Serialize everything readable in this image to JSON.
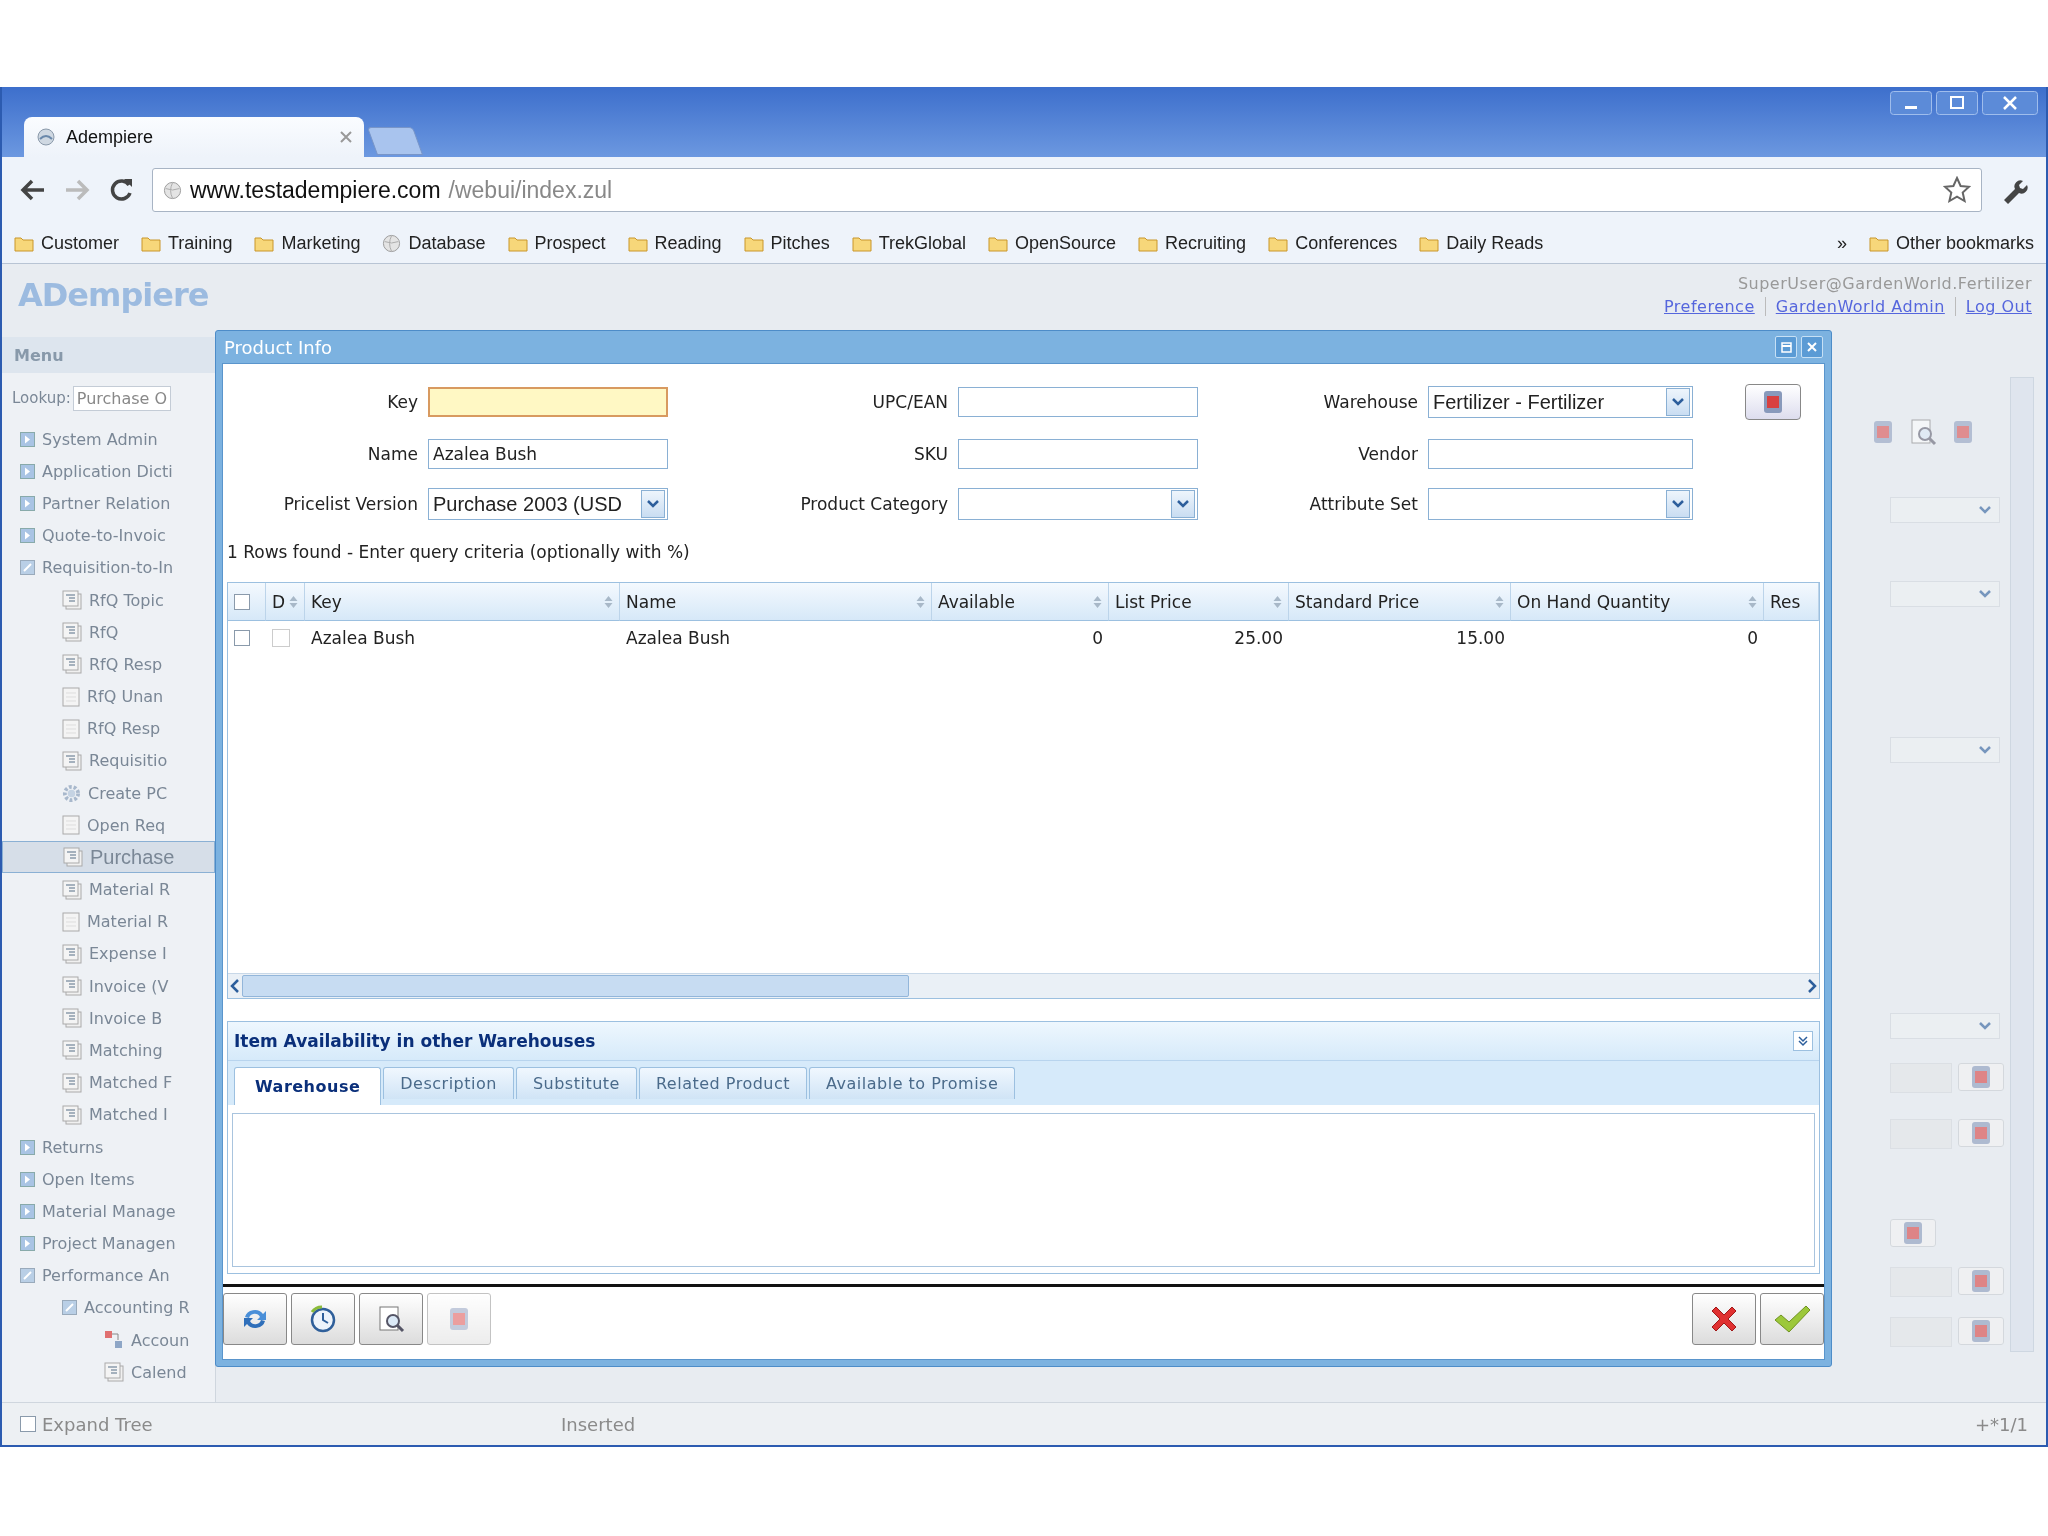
{
  "browser": {
    "tab_title": "Adempiere",
    "url_host": "www.testadempiere.com",
    "url_path": "/webui/index.zul",
    "bookmarks": [
      {
        "label": "Customer",
        "kind": "folder"
      },
      {
        "label": "Training",
        "kind": "folder"
      },
      {
        "label": "Marketing",
        "kind": "folder"
      },
      {
        "label": "Database",
        "kind": "page"
      },
      {
        "label": "Prospect",
        "kind": "folder"
      },
      {
        "label": "Reading",
        "kind": "folder"
      },
      {
        "label": "Pitches",
        "kind": "folder"
      },
      {
        "label": "TrekGlobal",
        "kind": "folder"
      },
      {
        "label": "OpenSource",
        "kind": "folder"
      },
      {
        "label": "Recruiting",
        "kind": "folder"
      },
      {
        "label": "Conferences",
        "kind": "folder"
      },
      {
        "label": "Daily Reads",
        "kind": "folder"
      }
    ],
    "overflow": "»",
    "other_bookmarks": "Other bookmarks"
  },
  "app": {
    "logo": "ADempiere",
    "user": "SuperUser@GardenWorld.Fertilizer",
    "links": [
      "Preference",
      "GardenWorld Admin",
      "Log Out"
    ],
    "menu_title": "Menu",
    "lookup_label": "Lookup:",
    "lookup_value": "Purchase O",
    "tree": [
      {
        "label": "System Admin",
        "kind": "folder",
        "expanded": false,
        "selected": false
      },
      {
        "label": "Application Dicti",
        "kind": "folder",
        "expanded": false,
        "selected": false
      },
      {
        "label": "Partner Relation",
        "kind": "folder",
        "expanded": false,
        "selected": false
      },
      {
        "label": "Quote-to-Invoic",
        "kind": "folder",
        "expanded": false,
        "selected": false
      },
      {
        "label": "Requisition-to-In",
        "kind": "folder",
        "expanded": true,
        "selected": false,
        "children": [
          {
            "label": "RfQ Topic",
            "kind": "window",
            "selected": false
          },
          {
            "label": "RfQ",
            "kind": "window",
            "selected": false
          },
          {
            "label": "RfQ Resp",
            "kind": "window",
            "selected": false
          },
          {
            "label": "RfQ Unan",
            "kind": "report",
            "selected": false
          },
          {
            "label": "RfQ Resp",
            "kind": "report",
            "selected": false
          },
          {
            "label": "Requisitio",
            "kind": "window",
            "selected": false
          },
          {
            "label": "Create PC",
            "kind": "process",
            "selected": false
          },
          {
            "label": "Open Req",
            "kind": "report",
            "selected": false
          },
          {
            "label": "Purchase",
            "kind": "window",
            "selected": true
          },
          {
            "label": "Material R",
            "kind": "window",
            "selected": false
          },
          {
            "label": "Material R",
            "kind": "report",
            "selected": false
          },
          {
            "label": "Expense I",
            "kind": "window",
            "selected": false
          },
          {
            "label": "Invoice (V",
            "kind": "window",
            "selected": false
          },
          {
            "label": "Invoice B",
            "kind": "window",
            "selected": false
          },
          {
            "label": "Matching",
            "kind": "window",
            "selected": false
          },
          {
            "label": "Matched F",
            "kind": "window",
            "selected": false
          },
          {
            "label": "Matched I",
            "kind": "window",
            "selected": false
          }
        ]
      },
      {
        "label": "Returns",
        "kind": "folder",
        "expanded": false,
        "selected": false
      },
      {
        "label": "Open Items",
        "kind": "folder",
        "expanded": false,
        "selected": false
      },
      {
        "label": "Material Manage",
        "kind": "folder",
        "expanded": false,
        "selected": false
      },
      {
        "label": "Project Managen",
        "kind": "folder",
        "expanded": false,
        "selected": false
      },
      {
        "label": "Performance An",
        "kind": "folder",
        "expanded": true,
        "selected": false,
        "children": [
          {
            "label": "Accounting R",
            "kind": "folder",
            "expanded": true,
            "selected": false,
            "children": [
              {
                "label": "Accoun",
                "kind": "workflow",
                "selected": false
              },
              {
                "label": "Calend",
                "kind": "window",
                "selected": false
              }
            ]
          }
        ]
      }
    ],
    "expand_tree": {
      "label": "Expand Tree",
      "checked": false
    },
    "status": "Inserted",
    "record": "+*1/1"
  },
  "dialog": {
    "title": "Product Info",
    "fields": [
      {
        "label": "Key",
        "kind": "text",
        "focused": true
      },
      {
        "label": "UPC/EAN",
        "kind": "text",
        "focused": false
      },
      {
        "label": "Warehouse",
        "kind": "select",
        "value": "Fertilizer - Fertilizer"
      },
      {
        "label": "Name",
        "kind": "text",
        "value": "Azalea Bush",
        "focused": false
      },
      {
        "label": "SKU",
        "kind": "text",
        "focused": false
      },
      {
        "label": "Vendor",
        "kind": "text",
        "focused": false
      },
      {
        "label": "Pricelist Version",
        "kind": "select",
        "value": "Purchase 2003 (USD"
      },
      {
        "label": "Product Category",
        "kind": "select"
      },
      {
        "label": "Attribute Set",
        "kind": "select"
      }
    ],
    "status": "1 Rows found - Enter query criteria (optionally with %)",
    "table": {
      "all_checked": false,
      "columns": [
        "D",
        "Key",
        "Name",
        "Available",
        "List Price",
        "Standard Price",
        "On Hand Quantity",
        "Res"
      ],
      "rows": [
        {
          "checked": false,
          "cells": [
            {
              "kind": "checkbox",
              "checked": false
            },
            {
              "kind": "text",
              "text": "Azalea Bush"
            },
            {
              "kind": "text",
              "text": "Azalea Bush"
            },
            {
              "kind": "number",
              "text": "0"
            },
            {
              "kind": "number",
              "text": "25.00"
            },
            {
              "kind": "number",
              "text": "15.00"
            },
            {
              "kind": "number",
              "text": "0"
            }
          ]
        }
      ]
    },
    "panel": {
      "title": "Item Availability in other Warehouses",
      "tabs": [
        {
          "label": "Warehouse",
          "selected": true
        },
        {
          "label": "Description",
          "selected": false
        },
        {
          "label": "Substitute",
          "selected": false
        },
        {
          "label": "Related Product",
          "selected": false
        },
        {
          "label": "Available to Promise",
          "selected": false
        }
      ]
    },
    "tools": [
      {
        "kind": "refresh",
        "disabled": false
      },
      {
        "kind": "history",
        "disabled": false
      },
      {
        "kind": "zoom",
        "disabled": false
      },
      {
        "kind": "record",
        "disabled": true
      }
    ],
    "actions": [
      {
        "kind": "cancel"
      },
      {
        "kind": "ok"
      }
    ]
  }
}
